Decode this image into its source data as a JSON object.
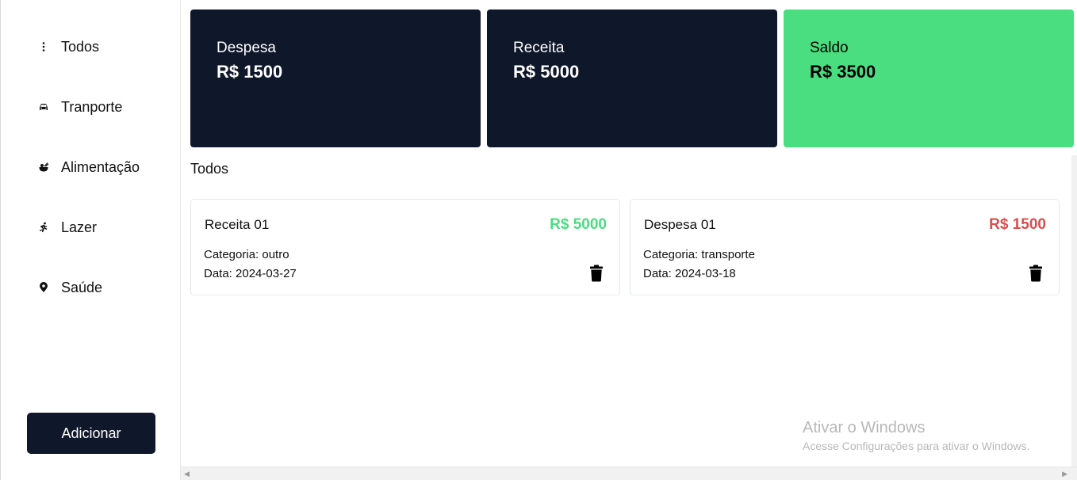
{
  "sidebar": {
    "items": [
      {
        "label": "Todos",
        "icon": "vertical-dots-icon"
      },
      {
        "label": "Tranporte",
        "icon": "car-icon"
      },
      {
        "label": "Alimentação",
        "icon": "bowl-food-icon"
      },
      {
        "label": "Lazer",
        "icon": "running-person-icon"
      },
      {
        "label": "Saúde",
        "icon": "location-pin-icon"
      }
    ],
    "add_button": "Adicionar"
  },
  "summary": {
    "expense": {
      "label": "Despesa",
      "value": "R$ 1500"
    },
    "income": {
      "label": "Receita",
      "value": "R$ 5000"
    },
    "balance": {
      "label": "Saldo",
      "value": "R$ 3500"
    }
  },
  "section_title": "Todos",
  "transactions": [
    {
      "name": "Receita 01",
      "amount": "R$ 5000",
      "category": "Categoria: outro",
      "date": "Data: 2024-03-27",
      "color": "#4ade80"
    },
    {
      "name": "Despesa 01",
      "amount": "R$ 1500",
      "category": "Categoria: transporte",
      "date": "Data: 2024-03-18",
      "color": "#dc4c4c"
    }
  ],
  "watermark": {
    "title": "Ativar o Windows",
    "subtitle": "Acesse Configurações para ativar o Windows."
  },
  "colors": {
    "dark": "#0f172a",
    "accent_green": "#4ade80",
    "expense_red": "#dc4c4c"
  }
}
